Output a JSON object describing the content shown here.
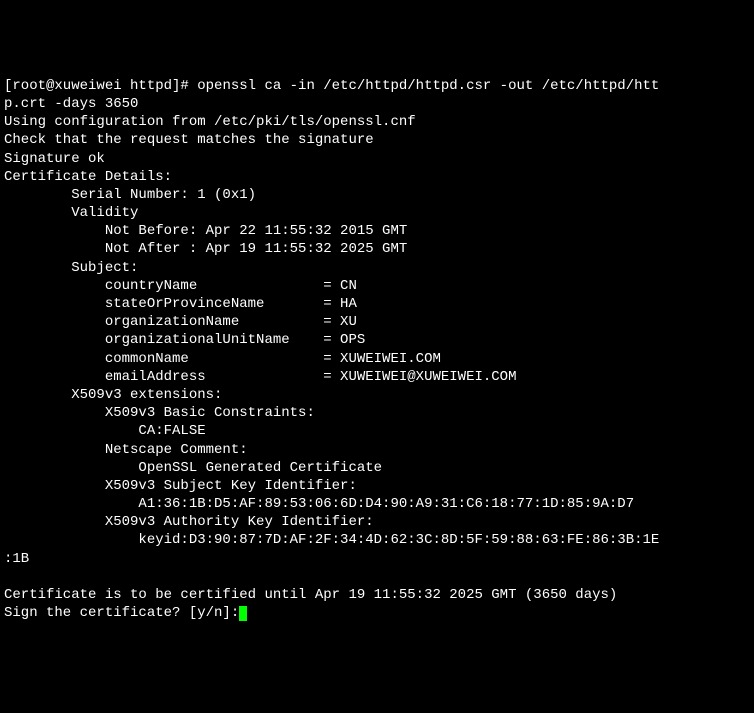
{
  "prompt_user": "[root@xuweiwei httpd]# ",
  "command": "openssl ca -in /etc/httpd/httpd.csr -out /etc/httpd/htt",
  "command_wrap": "p.crt -days 3650",
  "config_line": "Using configuration from /etc/pki/tls/openssl.cnf",
  "check_line": "Check that the request matches the signature",
  "sig_ok": "Signature ok",
  "cert_details_header": "Certificate Details:",
  "serial_line": "        Serial Number: 1 (0x1)",
  "validity_label": "        Validity",
  "not_before": "            Not Before: Apr 22 11:55:32 2015 GMT",
  "not_after": "            Not After : Apr 19 11:55:32 2025 GMT",
  "subject_label": "        Subject:",
  "country": "            countryName               = CN",
  "state": "            stateOrProvinceName       = HA",
  "org": "            organizationName          = XU",
  "org_unit": "            organizationalUnitName    = OPS",
  "common_name": "            commonName                = XUWEIWEI.COM",
  "email": "            emailAddress              = XUWEIWEI@XUWEIWEI.COM",
  "x509_ext": "        X509v3 extensions:",
  "basic_constraints": "            X509v3 Basic Constraints: ",
  "ca_false": "                CA:FALSE",
  "netscape": "            Netscape Comment: ",
  "openssl_gen": "                OpenSSL Generated Certificate",
  "subject_key": "            X509v3 Subject Key Identifier: ",
  "subject_key_val": "                A1:36:1B:D5:AF:89:53:06:6D:D4:90:A9:31:C6:18:77:1D:85:9A:D7",
  "auth_key": "            X509v3 Authority Key Identifier: ",
  "auth_key_val": "                keyid:D3:90:87:7D:AF:2F:34:4D:62:3C:8D:5F:59:88:63:FE:86:3B:1E",
  "auth_key_wrap": ":1B",
  "blank": "",
  "cert_until": "Certificate is to be certified until Apr 19 11:55:32 2025 GMT (3650 days)",
  "sign_prompt": "Sign the certificate? [y/n]:"
}
